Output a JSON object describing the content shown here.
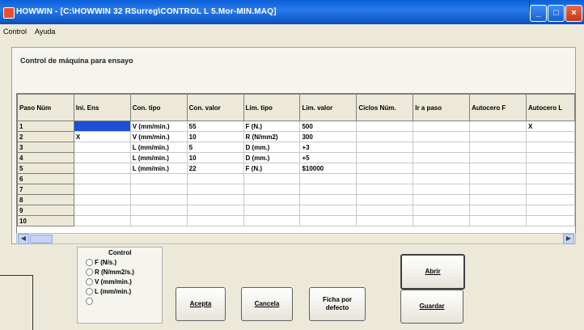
{
  "window": {
    "title": "HOWWIN - [C:\\HOWWIN 32 RSurreg\\CONTROL L 5.Mor-MIN.MAQ]",
    "controls": [
      "_",
      "□",
      "×"
    ]
  },
  "menu": [
    "Control",
    "Ayuda"
  ],
  "panel": {
    "title": "Control de máquina para ensayo"
  },
  "grid": {
    "columns": [
      "Paso Núm",
      "Ini. Ens",
      "Con. tipo",
      "Con. valor",
      "Lim. tipo",
      "Lim. valor",
      "Ciclos Núm.",
      "Ir a paso",
      "Autocero F",
      "Autocero L"
    ],
    "rows": [
      [
        "1",
        "",
        "V  (mm/min.)",
        "55",
        "F  (N.)",
        "500",
        "",
        "",
        "",
        "X"
      ],
      [
        "2",
        "X",
        "V  (mm/min.)",
        "10",
        "R  (N/mm2)",
        "300",
        "",
        "",
        "",
        ""
      ],
      [
        "3",
        "",
        "L (mm/min.)",
        "5",
        "D  (mm.)",
        "+3",
        "",
        "",
        "",
        ""
      ],
      [
        "4",
        "",
        "L (mm/min.)",
        "10",
        "D  (mm.)",
        "+5",
        "",
        "",
        "",
        ""
      ],
      [
        "5",
        "",
        "L (mm/min.)",
        "22",
        "F  (N.)",
        "$10000",
        "",
        "",
        "",
        ""
      ],
      [
        "6",
        "",
        "",
        "",
        "",
        "",
        "",
        "",
        "",
        ""
      ],
      [
        "7",
        "",
        "",
        "",
        "",
        "",
        "",
        "",
        "",
        ""
      ],
      [
        "8",
        "",
        "",
        "",
        "",
        "",
        "",
        "",
        "",
        ""
      ],
      [
        "9",
        "",
        "",
        "",
        "",
        "",
        "",
        "",
        "",
        ""
      ],
      [
        "10",
        "",
        "",
        "",
        "",
        "",
        "",
        "",
        "",
        ""
      ]
    ]
  },
  "control_group": {
    "title": "Control",
    "options": [
      "F (N/s.)",
      "R (N/mm2/s.)",
      "V  (mm/min.)",
      "L (mm/min.)",
      ""
    ]
  },
  "buttons": {
    "acepta": "Acepta",
    "cancela": "Cancela",
    "ficha_line1": "Ficha por",
    "ficha_line2": "defecto",
    "abrir": "Abrir",
    "guardar": "Guardar"
  },
  "colors": {
    "titlebar": "#0a5fd8",
    "selection": "#1c4fd8",
    "face": "#ece9d8"
  }
}
